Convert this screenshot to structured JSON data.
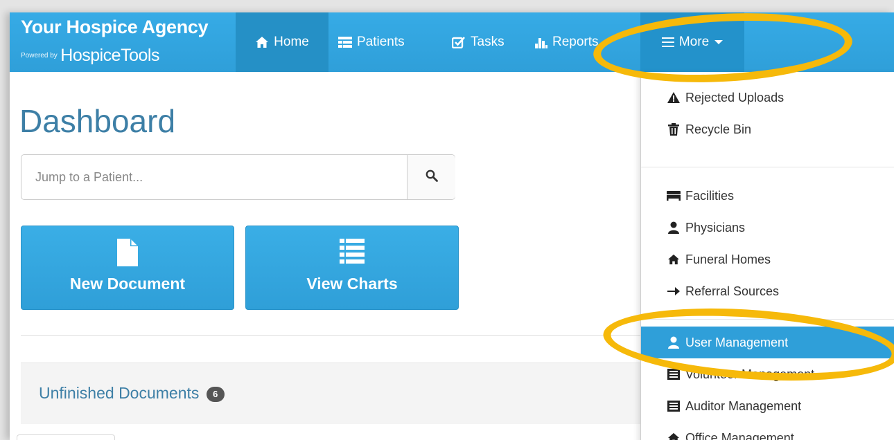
{
  "brand": {
    "title": "Your Hospice Agency",
    "powered_by": "Powered by",
    "logo_text": "HospiceTools"
  },
  "nav": {
    "items": [
      {
        "label": "Home",
        "icon": "home-icon"
      },
      {
        "label": "Patients",
        "icon": "patients-icon"
      },
      {
        "label": "Tasks",
        "icon": "tasks-check-icon"
      },
      {
        "label": "Reports",
        "icon": "reports-chart-icon"
      },
      {
        "label": "More",
        "icon": "hamburger-menu-icon"
      }
    ]
  },
  "dashboard": {
    "title": "Dashboard",
    "search": {
      "placeholder": "Jump to a Patient...",
      "value": ""
    },
    "buttons": {
      "new_document": "New Document",
      "view_charts": "View Charts"
    },
    "panel": {
      "title": "Unfinished Documents",
      "count": "6"
    }
  },
  "dropdown": {
    "items": [
      {
        "label": "Rejected Uploads",
        "icon": "warning-triangle-icon"
      },
      {
        "label": "Recycle Bin",
        "icon": "trash-icon"
      },
      {
        "label": "Facilities",
        "icon": "bed-icon"
      },
      {
        "label": "Physicians",
        "icon": "user-icon"
      },
      {
        "label": "Funeral Homes",
        "icon": "home-icon"
      },
      {
        "label": "Referral Sources",
        "icon": "arrow-right-icon"
      },
      {
        "label": "User Management",
        "icon": "user-icon",
        "selected": true
      },
      {
        "label": "Volunteer Management",
        "icon": "list-box-icon"
      },
      {
        "label": "Auditor Management",
        "icon": "list-box-icon"
      },
      {
        "label": "Office Management",
        "icon": "home-icon"
      }
    ]
  },
  "colors": {
    "navbar": "#31a6e1",
    "nav_active": "#2590c6",
    "title_blue": "#3d7fa6",
    "highlight_ring": "#f6b90a",
    "selected_item": "#2f9fd9"
  }
}
